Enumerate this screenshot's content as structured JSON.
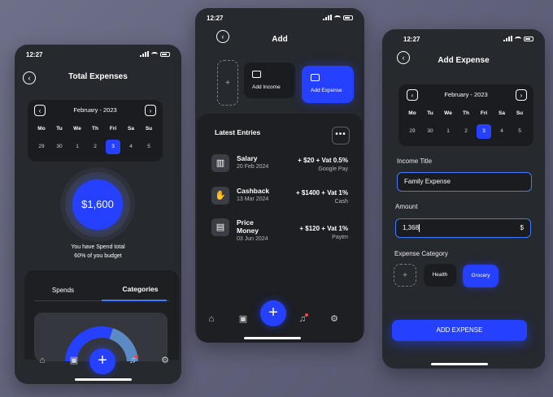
{
  "status": {
    "time": "12:27"
  },
  "screen1": {
    "title": "Total Expenses",
    "calendar": {
      "month": "February - 2023",
      "weekdays": [
        "Mo",
        "Tu",
        "We",
        "Th",
        "Fri",
        "Sa",
        "Su"
      ],
      "days": [
        "29",
        "30",
        "1",
        "2",
        "3",
        "4",
        "5"
      ],
      "selected_index": 4
    },
    "amount": "$1,600",
    "budget_text_1": "You have Spend total",
    "budget_text_2": "60% of you budget",
    "budget_fraction": 0.6,
    "tabs": {
      "spends": "Spends",
      "categories": "Categories",
      "active": "categories"
    }
  },
  "screen2": {
    "title": "Add",
    "add_income": "Add Income",
    "add_expense": "Add Expense",
    "latest_title": "Latest Entries",
    "entries": [
      {
        "name": "Salary",
        "date": "20 Feb 2024",
        "amount": "+ $20 + Vat 0.5%",
        "via": "Google Pay",
        "icon": "wallet-icon"
      },
      {
        "name": "Cashback",
        "date": "13 Mar 2024",
        "amount": "+ $1400 + Vat 1%",
        "via": "Cash",
        "icon": "cashback-icon"
      },
      {
        "name": "Price",
        "name2": "Money",
        "date": "03 Jun 2024",
        "amount": "+ $120 + Vat 1%",
        "via": "Paytm",
        "icon": "receipt-icon"
      }
    ]
  },
  "screen3": {
    "title": "Add Expense",
    "calendar": {
      "month": "February - 2023",
      "weekdays": [
        "Mo",
        "Tu",
        "We",
        "Th",
        "Fri",
        "Sa",
        "Su"
      ],
      "days": [
        "29",
        "30",
        "1",
        "2",
        "3",
        "4",
        "5"
      ],
      "selected_index": 4
    },
    "income_title_label": "Income Title",
    "income_title_value": "Family Expense",
    "amount_label": "Amount",
    "amount_value": "1,368",
    "currency": "$",
    "category_label": "Expense Category",
    "categories": [
      "Health",
      "Grocery"
    ],
    "selected_category": "Grocery",
    "submit": "ADD EXPENSE"
  },
  "colors": {
    "accent": "#2541ff",
    "panel": "#26292e",
    "dark": "#1a1c20"
  }
}
